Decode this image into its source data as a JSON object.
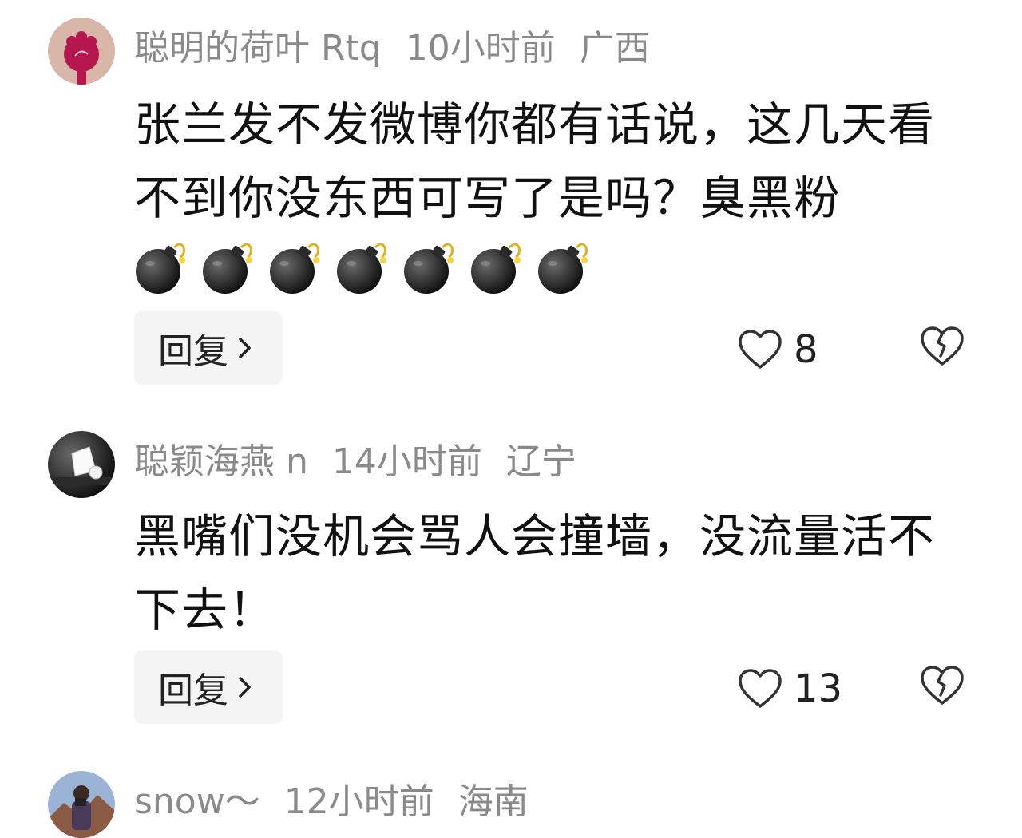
{
  "comments": [
    {
      "username": "聪明的荷叶 Rtq",
      "time": "10小时前",
      "location": "广西",
      "text": "张兰发不发微博你都有话说，这几天看不到你没东西可写了是吗？臭黑粉",
      "emoji_count": 7,
      "emoji_name": "bomb",
      "reply_label": "回复",
      "like_count": "8"
    },
    {
      "username": "聪颖海燕 n",
      "time": "14小时前",
      "location": "辽宁",
      "text": "黑嘴们没机会骂人会撞墙，没流量活不下去！",
      "reply_label": "回复",
      "like_count": "13"
    },
    {
      "username": "snow～",
      "time": "12小时前",
      "location": "海南"
    }
  ],
  "icons": {
    "like": "heart-outline-icon",
    "dislike": "broken-heart-icon",
    "reply_arrow": "chevron-right-icon"
  },
  "colors": {
    "meta_text": "#8a8a8a",
    "body_text": "#111111",
    "reply_bg": "#f4f4f4"
  }
}
